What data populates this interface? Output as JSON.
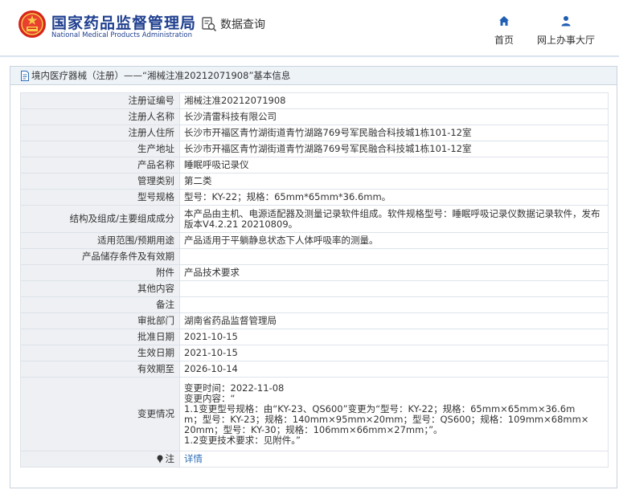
{
  "header": {
    "site_name_cn": "国家药品监督管理局",
    "site_name_en": "National Medical Products Administration",
    "db_query_label": "数据查询",
    "nav": {
      "home_label": "首页",
      "online_hall_label": "网上办事大厅"
    }
  },
  "panel": {
    "title": "境内医疗器械（注册）——“湘械注准20212071908”基本信息"
  },
  "record": {
    "reg_no_label": "注册证编号",
    "reg_no": "湘械注准20212071908",
    "registrant_label": "注册人名称",
    "registrant": "长沙清雷科技有限公司",
    "registrant_addr_label": "注册人住所",
    "registrant_addr": "长沙市开福区青竹湖街道青竹湖路769号军民融合科技城1栋101-12室",
    "production_addr_label": "生产地址",
    "production_addr": "长沙市开福区青竹湖街道青竹湖路769号军民融合科技城1栋101-12室",
    "product_name_label": "产品名称",
    "product_name": "睡眠呼吸记录仪",
    "category_label": "管理类别",
    "category": "第二类",
    "model_label": "型号规格",
    "model": "型号：KY-22；规格：65mm*65mm*36.6mm。",
    "structure_label": "结构及组成/主要组成成分",
    "structure": "本产品由主机、电源适配器及测量记录软件组成。软件规格型号：睡眠呼吸记录仪数据记录软件，发布版本V4.2.21 20210809。",
    "scope_label": "适用范围/预期用途",
    "scope": "产品适用于平躺静息状态下人体呼吸率的测量。",
    "storage_label": "产品储存条件及有效期",
    "storage": "",
    "attachment_label": "附件",
    "attachment": "产品技术要求",
    "other_label": "其他内容",
    "other": "",
    "remark_label": "备注",
    "remark": "",
    "approval_dept_label": "审批部门",
    "approval_dept": "湖南省药品监督管理局",
    "approval_date_label": "批准日期",
    "approval_date": "2021-10-15",
    "effective_date_label": "生效日期",
    "effective_date": "2021-10-15",
    "expiry_label": "有效期至",
    "expiry": "2026-10-14",
    "change_label": "变更情况",
    "change_lines": [
      "变更时间：2022-11-08",
      "变更内容：“",
      "1.1变更型号规格：由“KY-23、QS600”变更为“型号：KY-22；规格：65mm×65mm×36.6m",
      "m；型号：KY-23；规格：140mm×95mm×20mm；型号：QS600；规格：109mm×68mm×",
      "20mm；型号：KY-30；规格：106mm×66mm×27mm；”。",
      "1.2变更技术要求：见附件。”"
    ],
    "note_label": "注",
    "note_link": "详情"
  },
  "colors": {
    "brand_blue": "#1f3f8f",
    "nav_icon_blue": "#1f5fb3",
    "link_blue": "#2e6fb7",
    "key_cell_bg": "#eef0f3",
    "title_bar_bg": "#eef3f8"
  },
  "icons": {
    "logo": "national-emblem-icon",
    "db_query": "database-search-icon",
    "home": "home-icon",
    "hall": "person-icon",
    "title": "document-icon",
    "note": "pin-icon"
  }
}
